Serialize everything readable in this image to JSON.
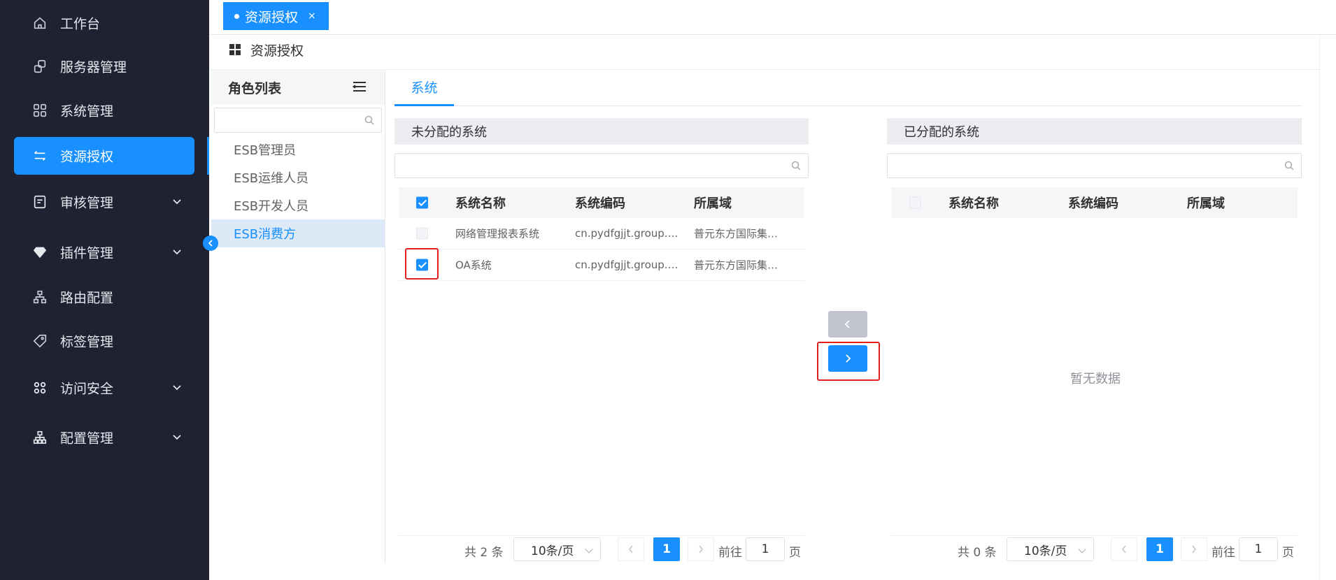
{
  "sidebar": {
    "items": [
      {
        "label": "工作台",
        "icon": "home-icon"
      },
      {
        "label": "服务器管理",
        "icon": "server-icon"
      },
      {
        "label": "系统管理",
        "icon": "grid-icon"
      },
      {
        "label": "资源授权",
        "icon": "swap-icon",
        "active": true
      },
      {
        "label": "审核管理",
        "icon": "audit-icon"
      },
      {
        "label": "插件管理",
        "icon": "diamond-icon"
      },
      {
        "label": "路由配置",
        "icon": "route-icon"
      },
      {
        "label": "标签管理",
        "icon": "tag-icon"
      },
      {
        "label": "访问安全",
        "icon": "security-icon"
      },
      {
        "label": "配置管理",
        "icon": "config-icon"
      }
    ]
  },
  "tabs": {
    "active": "资源授权",
    "close": "×"
  },
  "breadcrumb": {
    "title": "资源授权"
  },
  "roles": {
    "title": "角色列表",
    "search_placeholder": "",
    "items": [
      "ESB管理员",
      "ESB运维人员",
      "ESB开发人员",
      "ESB消费方"
    ],
    "active_index": 3
  },
  "system_tab": {
    "label": "系统"
  },
  "unassigned": {
    "title": "未分配的系统",
    "columns": [
      "系统名称",
      "系统编码",
      "所属域"
    ],
    "rows": [
      {
        "name": "网络管理报表系统",
        "code": "cn.pydfgjjt.group.…",
        "domain": "普元东方国际集…",
        "checked": false
      },
      {
        "name": "OA系统",
        "code": "cn.pydfgjjt.group.…",
        "domain": "普元东方国际集…",
        "checked": true
      }
    ],
    "pager": {
      "total": "共 2 条",
      "size": "10条/页",
      "page": "1",
      "goto": "前往",
      "goto_value": "1",
      "unit": "页"
    }
  },
  "assigned": {
    "title": "已分配的系统",
    "columns": [
      "系统名称",
      "系统编码",
      "所属域"
    ],
    "empty": "暂无数据",
    "pager": {
      "total": "共 0 条",
      "size": "10条/页",
      "page": "1",
      "goto": "前往",
      "goto_value": "1",
      "unit": "页"
    }
  },
  "colors": {
    "primary": "#1890ff",
    "sidebar": "#1f2233",
    "highlight": "#e02020"
  }
}
